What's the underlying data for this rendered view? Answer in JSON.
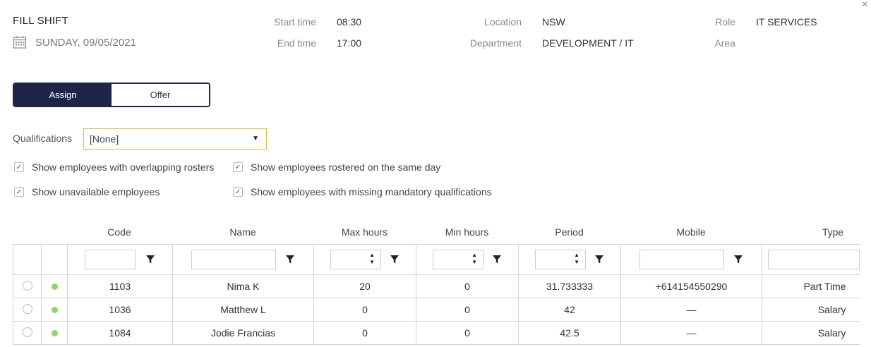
{
  "header": {
    "title": "FILL SHIFT",
    "date": "SUNDAY, 09/05/2021",
    "close_icon": "×",
    "start_label": "Start time",
    "start_value": "08:30",
    "end_label": "End time",
    "end_value": "17:00",
    "location_label": "Location",
    "location_value": "NSW",
    "department_label": "Department",
    "department_value": "DEVELOPMENT / IT",
    "role_label": "Role",
    "role_value": "IT SERVICES",
    "area_label": "Area"
  },
  "toggle": {
    "assign_label": "Assign",
    "offer_label": "Offer",
    "selected": "Assign"
  },
  "qualifications": {
    "label": "Qualifications",
    "value": "[None]"
  },
  "options": [
    {
      "label": "Show employees with overlapping rosters",
      "checked": true
    },
    {
      "label": "Show employees rostered on the same day",
      "checked": true
    },
    {
      "label": "Show unavailable employees",
      "checked": true
    },
    {
      "label": "Show employees with missing mandatory qualifications",
      "checked": true
    }
  ],
  "table": {
    "headers": [
      "Code",
      "Name",
      "Max hours",
      "Min hours",
      "Period",
      "Mobile",
      "Type"
    ],
    "rows": [
      {
        "code": "1103",
        "name": "Nima K",
        "max": "20",
        "min": "0",
        "period": "31.733333",
        "mobile": "+614154550290",
        "type": "Part Time"
      },
      {
        "code": "1036",
        "name": "Matthew L",
        "max": "0",
        "min": "0",
        "period": "42",
        "mobile": "—",
        "type": "Salary"
      },
      {
        "code": "1084",
        "name": "Jodie Francias",
        "max": "0",
        "min": "0",
        "period": "42.5",
        "mobile": "—",
        "type": "Salary"
      }
    ]
  },
  "colors": {
    "accent": "#1f2548",
    "select_border": "#e0b63a",
    "status_dot": "#8ed46c"
  }
}
